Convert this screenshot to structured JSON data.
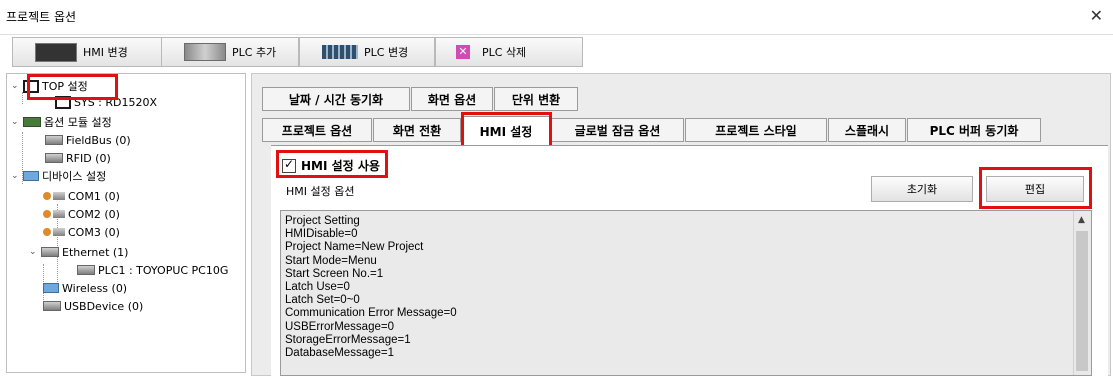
{
  "window": {
    "title": "프로젝트 옵션",
    "close": "✕"
  },
  "toolbar": {
    "hmi_change": "HMI 변경",
    "plc_add": "PLC 추가",
    "plc_change": "PLC 변경",
    "plc_delete": "PLC 삭제",
    "delete_icon": "✕"
  },
  "tree": {
    "items": [
      "TOP 설정",
      "SYS : RD1520X",
      "옵션 모듈 설정",
      "FieldBus (0)",
      "RFID (0)",
      "디바이스 설정",
      "COM1 (0)",
      "COM2 (0)",
      "COM3 (0)",
      "Ethernet (1)",
      "PLC1 : TOYOPUC PC10G",
      "Wireless (0)",
      "USBDevice (0)"
    ]
  },
  "tabs_row1": [
    "날짜 / 시간 동기화",
    "화면 옵션",
    "단위 변환"
  ],
  "tabs_row2": [
    "프로젝트 옵션",
    "화면 전환",
    "HMI 설정",
    "글로벌 잠금 옵션",
    "프로젝트 스타일",
    "스플래시",
    "PLC 버퍼 동기화"
  ],
  "hmi": {
    "use_label": "HMI 설정 사용",
    "use_checked": true,
    "options_label": "HMI 설정 옵션",
    "reset_button": "초기화",
    "edit_button": "편집",
    "settings_lines": [
      "Project Setting",
      "HMIDisable=0",
      "Project Name=New Project",
      "Start Mode=Menu",
      "Start Screen No.=1",
      "Latch Use=0",
      "Latch Set=0~0",
      "Communication Error Message=0",
      "USBErrorMessage=0",
      "StorageErrorMessage=1",
      "DatabaseMessage=1"
    ]
  },
  "colors": {
    "highlight": "#e01010"
  }
}
